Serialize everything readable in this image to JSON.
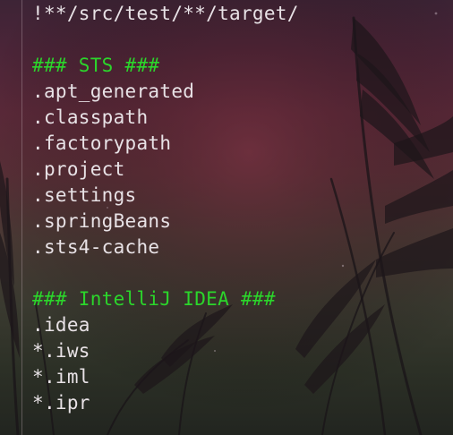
{
  "editor": {
    "lines": [
      {
        "text": "!**/src/test/**/target/",
        "kind": "code"
      },
      {
        "text": "",
        "kind": "blank"
      },
      {
        "text": "### STS ###",
        "kind": "comment"
      },
      {
        "text": ".apt_generated",
        "kind": "code"
      },
      {
        "text": ".classpath",
        "kind": "code"
      },
      {
        "text": ".factorypath",
        "kind": "code"
      },
      {
        "text": ".project",
        "kind": "code"
      },
      {
        "text": ".settings",
        "kind": "code"
      },
      {
        "text": ".springBeans",
        "kind": "code"
      },
      {
        "text": ".sts4-cache",
        "kind": "code"
      },
      {
        "text": "",
        "kind": "blank"
      },
      {
        "text": "### IntelliJ IDEA ###",
        "kind": "comment"
      },
      {
        "text": ".idea",
        "kind": "code"
      },
      {
        "text": "*.iws",
        "kind": "code"
      },
      {
        "text": "*.iml",
        "kind": "code"
      },
      {
        "text": "*.ipr",
        "kind": "code"
      }
    ]
  },
  "colors": {
    "text": "#e8e2e6",
    "comment": "#2bd62b",
    "background_top": "#4c2538",
    "background_bottom": "#222520"
  }
}
